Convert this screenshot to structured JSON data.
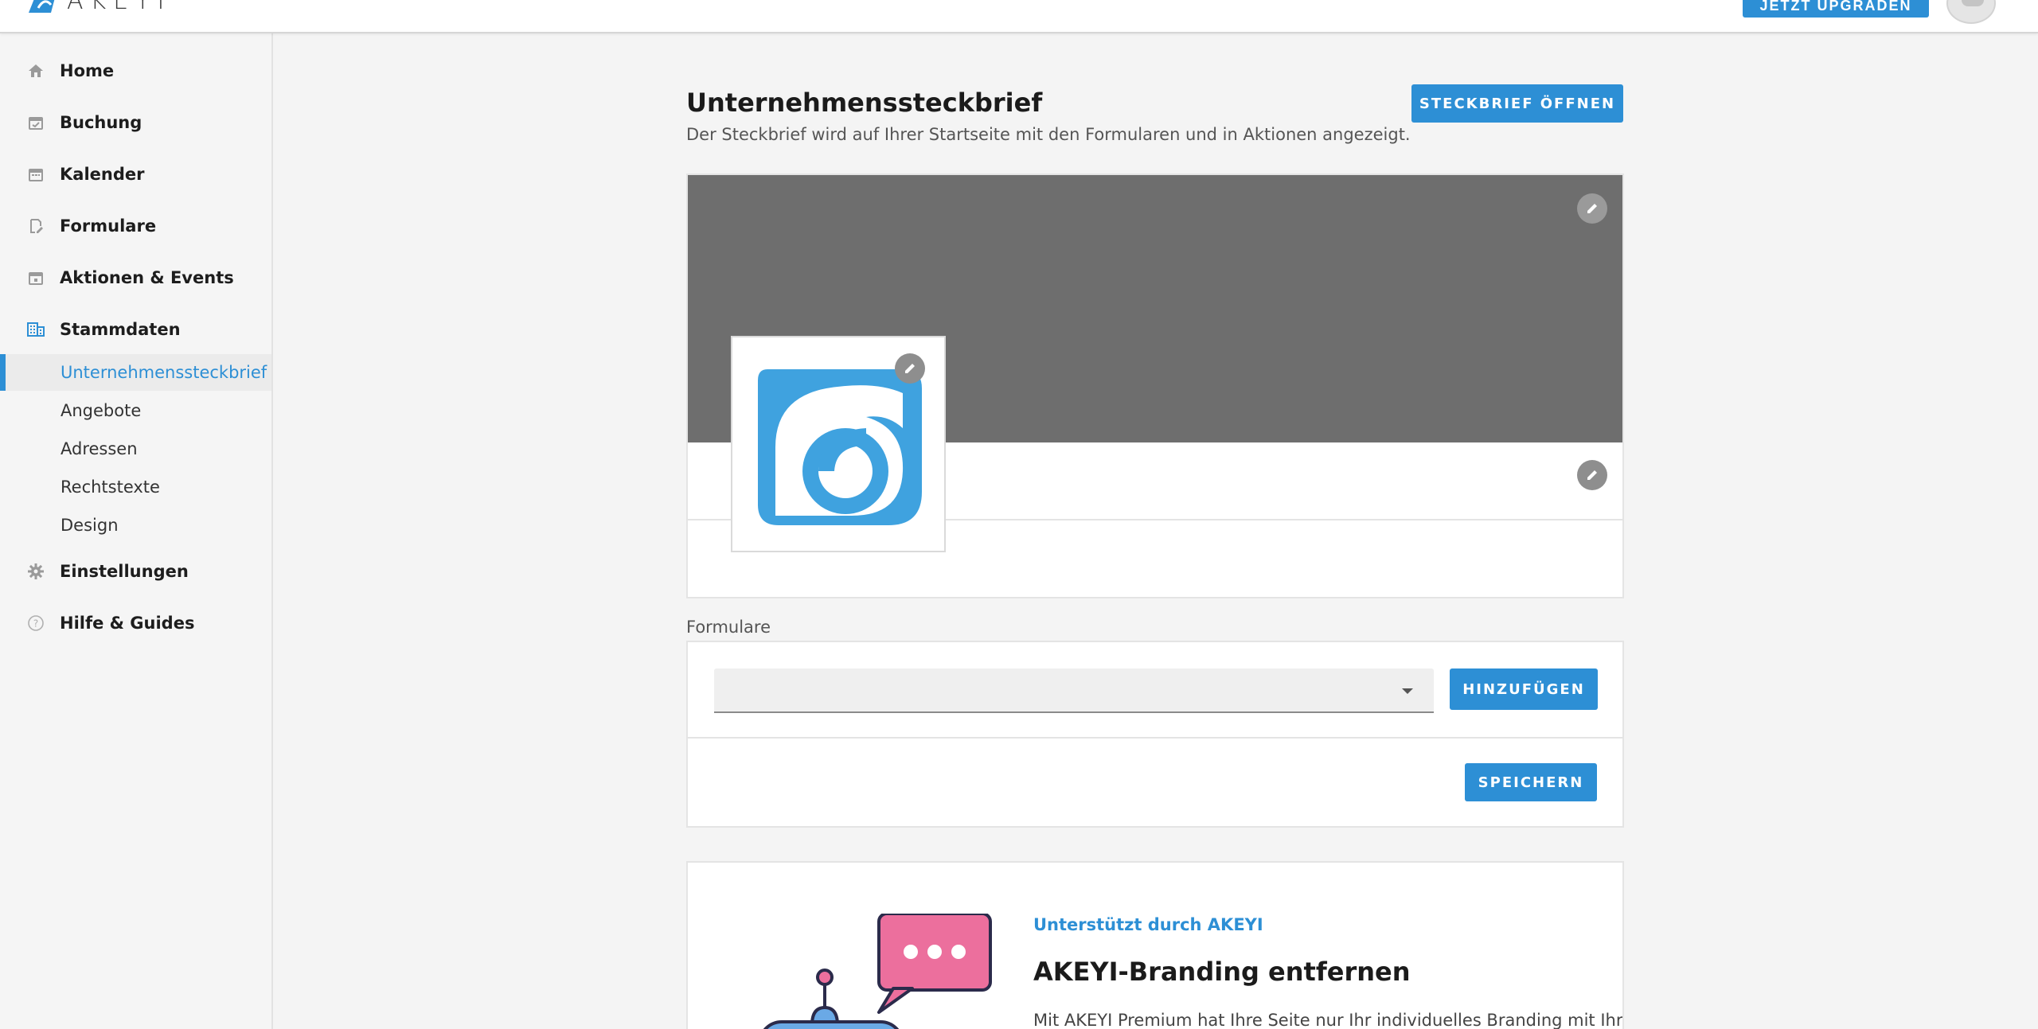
{
  "header": {
    "brand": "AKEYI",
    "upgrade_label": "JETZT UPGRADEN",
    "accent": "#2d8fd5"
  },
  "sidebar": {
    "items": [
      {
        "label": "Home",
        "icon": "home-icon"
      },
      {
        "label": "Buchung",
        "icon": "calendar-check-icon"
      },
      {
        "label": "Kalender",
        "icon": "calendar-icon"
      },
      {
        "label": "Formulare",
        "icon": "form-edit-icon"
      },
      {
        "label": "Aktionen & Events",
        "icon": "calendar-event-icon"
      },
      {
        "label": "Stammdaten",
        "icon": "building-icon"
      }
    ],
    "subitems": [
      {
        "label": "Unternehmenssteckbrief",
        "active": true
      },
      {
        "label": "Angebote"
      },
      {
        "label": "Adressen"
      },
      {
        "label": "Rechtstexte"
      },
      {
        "label": "Design"
      }
    ],
    "bottom_items": [
      {
        "label": "Einstellungen",
        "icon": "gear-icon"
      },
      {
        "label": "Hilfe & Guides",
        "icon": "help-icon"
      }
    ]
  },
  "main": {
    "title": "Unternehmenssteckbrief",
    "subtitle": "Der Steckbrief wird auf Ihrer Startseite mit den Formularen und in Aktionen angezeigt.",
    "open_button": "STECKBRIEF ÖFFNEN",
    "cover_color": "#6e6e6e",
    "forms": {
      "label": "Formulare",
      "select_value": "",
      "add_button": "HINZUFÜGEN",
      "save_button": "SPEICHERN"
    },
    "promo": {
      "tag": "Unterstützt durch AKEYI",
      "title": "AKEYI-Branding entfernen",
      "text": "Mit AKEYI Premium hat Ihre Seite nur Ihr individuelles Branding mit Ihrer"
    }
  }
}
